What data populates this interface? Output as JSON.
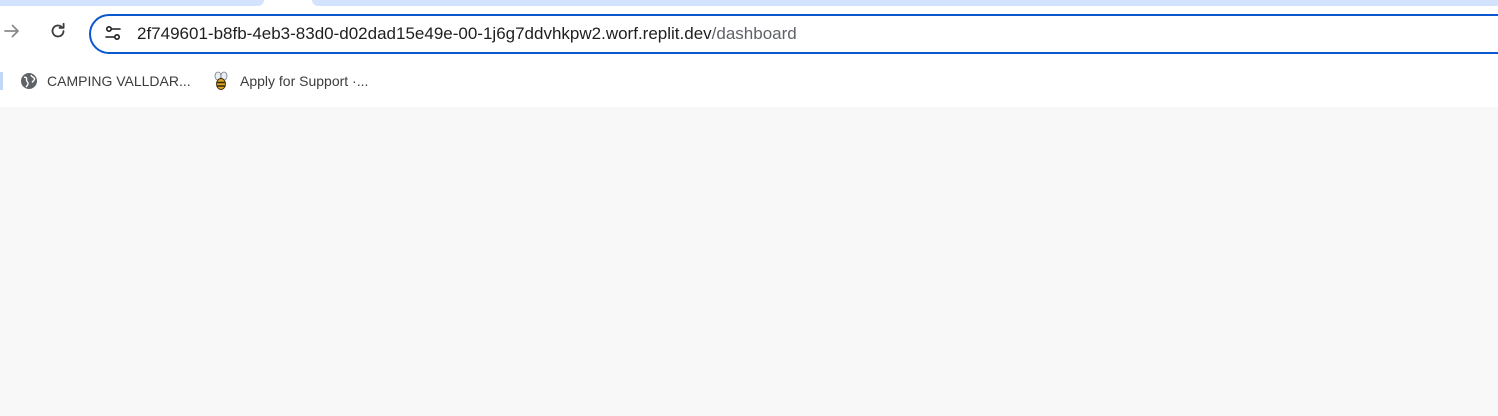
{
  "address_bar": {
    "url_host": "2f749601-b8fb-4eb3-83d0-d02dad15e49e-00-1j6g7ddvhkpw2.worf.replit.dev",
    "url_path": "/dashboard"
  },
  "icons": {
    "forward": "arrow-right-icon",
    "reload": "reload-icon",
    "site_info": "tune-icon"
  },
  "bookmarks": [
    {
      "label": "CAMPING VALLDAR...",
      "icon": "globe-icon"
    },
    {
      "label": "Apply for Support  ·...",
      "icon": "bee-icon"
    }
  ],
  "colors": {
    "focus_ring": "#0b57d0",
    "tab_strip": "#d3e3fd",
    "page_background": "#f8f8f8"
  }
}
